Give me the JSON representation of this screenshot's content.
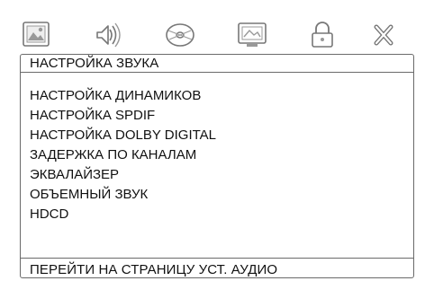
{
  "toolbar": {
    "icons": [
      {
        "name": "picture-icon"
      },
      {
        "name": "audio-icon"
      },
      {
        "name": "disc-icon"
      },
      {
        "name": "display-icon"
      },
      {
        "name": "lock-icon"
      },
      {
        "name": "exit-icon"
      }
    ]
  },
  "page": {
    "title": "НАСТРОЙКА ЗВУКА",
    "footer": "ПЕРЕЙТИ НА СТРАНИЦУ УСТ. АУДИО"
  },
  "menu": {
    "items": [
      {
        "label": "НАСТРОЙКА ДИНАМИКОВ"
      },
      {
        "label": "НАСТРОЙКА SPDIF"
      },
      {
        "label": "НАСТРОЙКА DOLBY DIGITAL"
      },
      {
        "label": "ЗАДЕРЖКА ПО КАНАЛАМ"
      },
      {
        "label": "ЭКВАЛАЙЗЕР"
      },
      {
        "label": "ОБЪЕМНЫЙ ЗВУК"
      },
      {
        "label": "HDCD"
      }
    ]
  }
}
